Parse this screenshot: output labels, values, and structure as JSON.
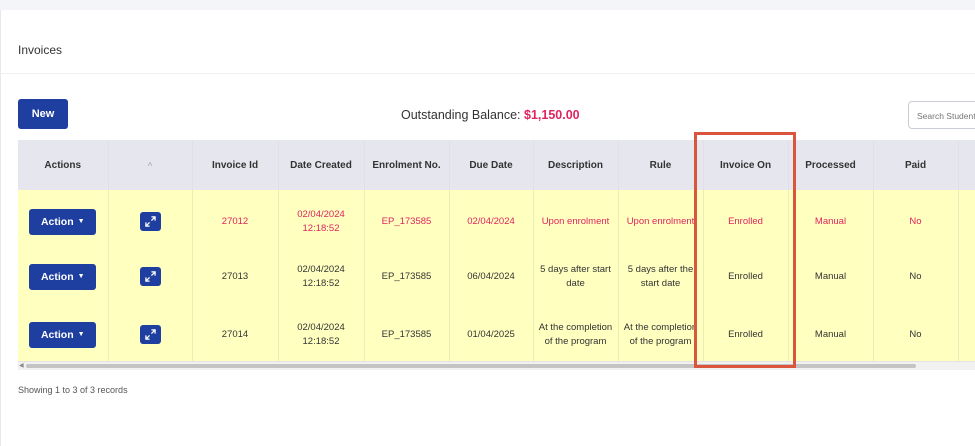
{
  "card": {
    "title": "Invoices"
  },
  "toolbar": {
    "new_label": "New",
    "balance_label": "Outstanding Balance:",
    "balance_value": "$1,150.00",
    "search_placeholder": "Search Student"
  },
  "table": {
    "headers": [
      "Actions",
      "",
      "Invoice Id",
      "Date Created",
      "Enrolment No.",
      "Due Date",
      "Description",
      "Rule",
      "Invoice On",
      "Processed",
      "Paid"
    ],
    "action_label": "Action",
    "rows": [
      {
        "invoice_id": "27012",
        "date_created": "02/04/2024 12:18:52",
        "enrolment_no": "EP_173585",
        "due_date": "02/04/2024",
        "description": "Upon enrolment",
        "rule": "Upon enrolment",
        "invoice_on": "Enrolled",
        "processed": "Manual",
        "paid": "No"
      },
      {
        "invoice_id": "27013",
        "date_created": "02/04/2024 12:18:52",
        "enrolment_no": "EP_173585",
        "due_date": "06/04/2024",
        "description": "5 days after start date",
        "rule": "5 days after the start date",
        "invoice_on": "Enrolled",
        "processed": "Manual",
        "paid": "No"
      },
      {
        "invoice_id": "27014",
        "date_created": "02/04/2024 12:18:52",
        "enrolment_no": "EP_173585",
        "due_date": "01/04/2025",
        "description": "At the completion of the program",
        "rule": "At the completion of the program",
        "invoice_on": "Enrolled",
        "processed": "Manual",
        "paid": "No"
      }
    ]
  },
  "footer": {
    "showing": "Showing 1 to 3 of 3 records"
  },
  "colors": {
    "primary": "#1f3fa0",
    "row_highlight": "#ffffc0",
    "alert_text": "#e0245e",
    "annotation_box": "#d9553b"
  },
  "icons": {
    "sort": "chevron-up-icon",
    "expand": "expand-arrows-icon",
    "dropdown": "caret-down-icon"
  }
}
